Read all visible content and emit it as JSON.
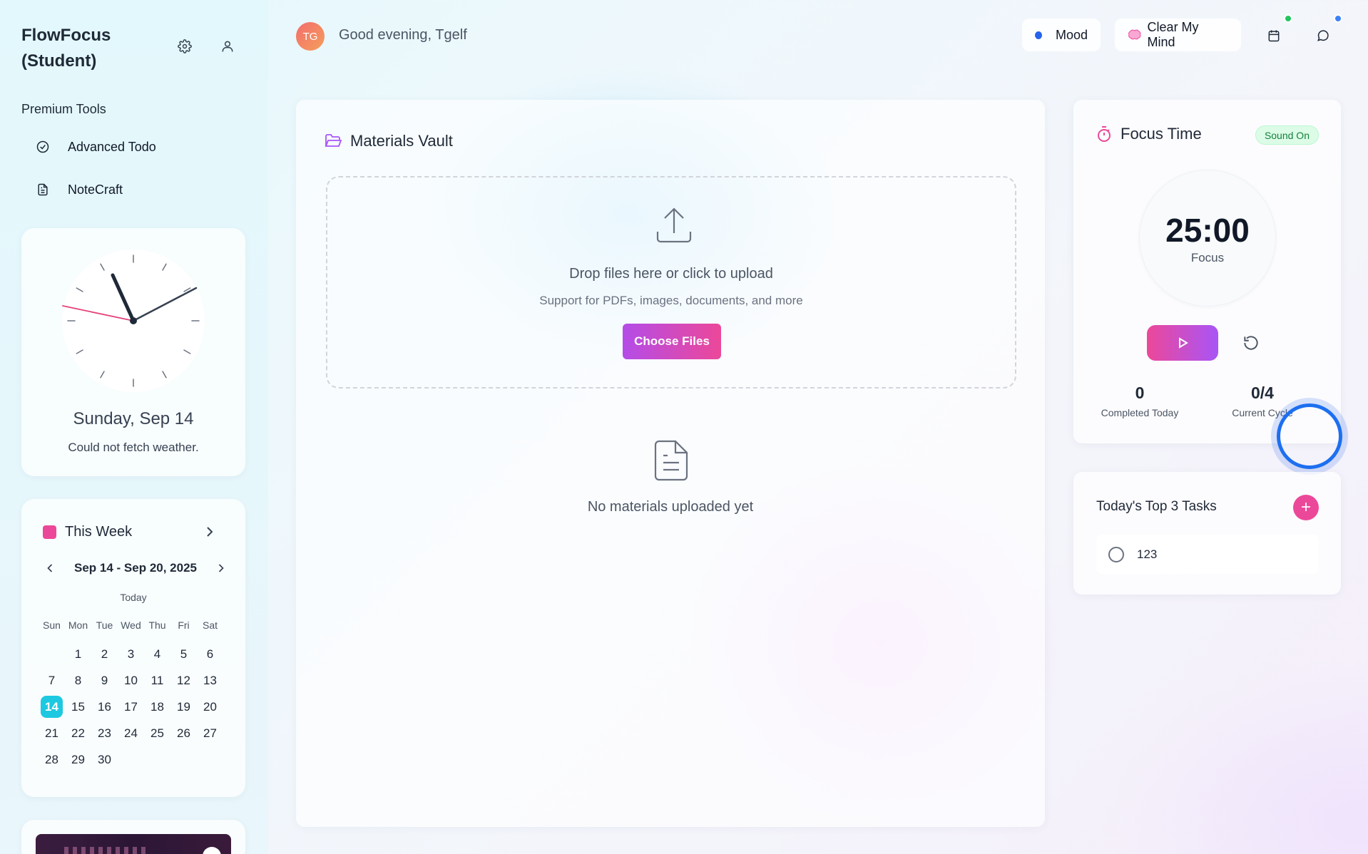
{
  "sidebar": {
    "brand": "FlowFocus (Student)",
    "section_title": "Premium Tools",
    "tools": [
      {
        "label": "Advanced Todo",
        "icon": "check-circle-icon"
      },
      {
        "label": "NoteCraft",
        "icon": "document-icon"
      }
    ],
    "clock": {
      "date": "Sunday, Sep 14",
      "weather": "Could not fetch weather."
    },
    "week": {
      "title": "This Week",
      "range": "Sep 14 - Sep 20, 2025",
      "today_label": "Today",
      "weekdays": [
        "Sun",
        "Mon",
        "Tue",
        "Wed",
        "Thu",
        "Fri",
        "Sat"
      ],
      "leading_blanks": 1,
      "days": [
        "1",
        "2",
        "3",
        "4",
        "5",
        "6",
        "7",
        "8",
        "9",
        "10",
        "11",
        "12",
        "13",
        "14",
        "15",
        "16",
        "17",
        "18",
        "19",
        "20",
        "21",
        "22",
        "23",
        "24",
        "25",
        "26",
        "27",
        "28",
        "29",
        "30"
      ],
      "selected_day": "14",
      "accent": "#ec4899",
      "today_color": "#1ec8e0"
    }
  },
  "header": {
    "avatar_initials": "TG",
    "greeting": "Good evening, Tgelf",
    "mood_label": "Mood",
    "clear_label": "Clear My Mind"
  },
  "vault": {
    "title": "Materials Vault",
    "drop_main": "Drop files here or click to upload",
    "drop_sub": "Support for PDFs, images, documents, and more",
    "choose_label": "Choose Files",
    "empty_text": "No materials uploaded yet"
  },
  "focus": {
    "title": "Focus Time",
    "sound_badge": "Sound On",
    "timer": "25:00",
    "mode": "Focus",
    "completed_value": "0",
    "completed_label": "Completed Today",
    "cycle_value": "0/4",
    "cycle_label": "Current Cycle"
  },
  "tasks": {
    "title": "Today's Top 3 Tasks",
    "items": [
      {
        "text": "123"
      }
    ]
  }
}
